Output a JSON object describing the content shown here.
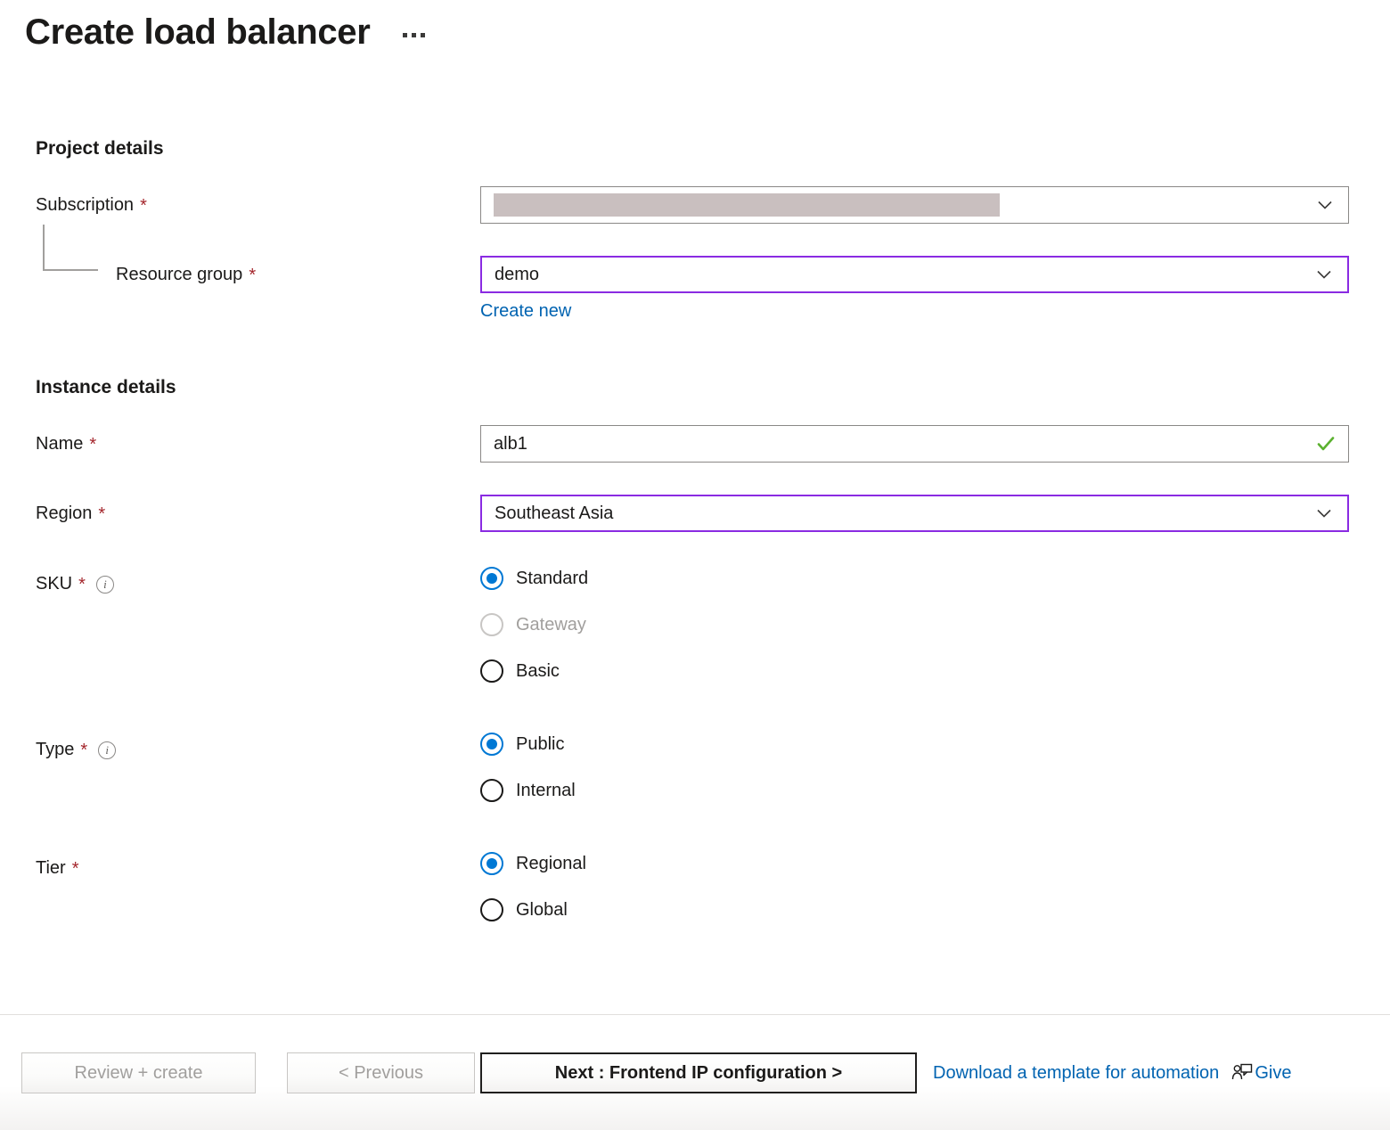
{
  "header": {
    "title": "Create load balancer",
    "more_button": "···"
  },
  "sections": {
    "project_details": "Project details",
    "instance_details": "Instance details"
  },
  "fields": {
    "subscription": {
      "label": "Subscription",
      "required": "*",
      "value": "",
      "redacted": true
    },
    "resource_group": {
      "label": "Resource group",
      "required": "*",
      "value": "demo",
      "create_new_link": "Create new"
    },
    "name": {
      "label": "Name",
      "required": "*",
      "value": "alb1",
      "validation": "valid"
    },
    "region": {
      "label": "Region",
      "required": "*",
      "value": "Southeast Asia"
    },
    "sku": {
      "label": "SKU",
      "required": "*",
      "has_info": true,
      "options": [
        {
          "label": "Standard",
          "selected": true,
          "disabled": false
        },
        {
          "label": "Gateway",
          "selected": false,
          "disabled": true
        },
        {
          "label": "Basic",
          "selected": false,
          "disabled": false
        }
      ]
    },
    "type": {
      "label": "Type",
      "required": "*",
      "has_info": true,
      "options": [
        {
          "label": "Public",
          "selected": true,
          "disabled": false
        },
        {
          "label": "Internal",
          "selected": false,
          "disabled": false
        }
      ]
    },
    "tier": {
      "label": "Tier",
      "required": "*",
      "has_info": false,
      "options": [
        {
          "label": "Regional",
          "selected": true,
          "disabled": false
        },
        {
          "label": "Global",
          "selected": false,
          "disabled": false
        }
      ]
    }
  },
  "footer": {
    "review_create": "Review + create",
    "previous": "< Previous",
    "next": "Next : Frontend IP configuration >",
    "download_template": "Download a template for automation",
    "give_feedback": "Give"
  },
  "colors": {
    "accent_blue": "#0078d4",
    "link_blue": "#0063b1",
    "required_red": "#a4262c",
    "focus_purple": "#8a2be2",
    "valid_green": "#5bb12f",
    "redaction_gray": "#c9bfbf"
  }
}
